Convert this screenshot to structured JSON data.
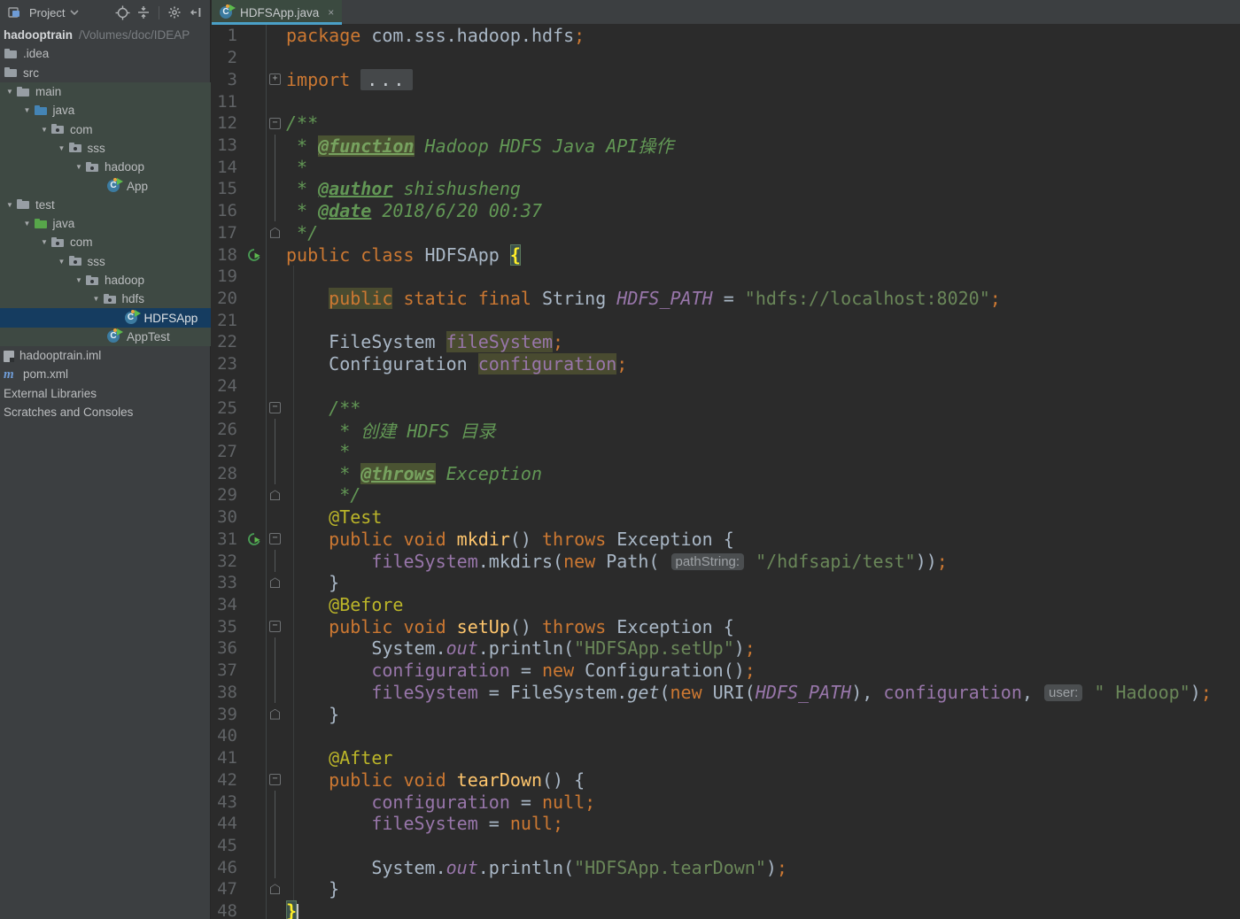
{
  "colors": {
    "accent_tab_underline": "#4AA0C8",
    "selection": "#153C60",
    "tree_tint": "#3E4943",
    "editor_bg": "#2B2B2B",
    "panel_bg": "#3C3F41",
    "keyword": "#CC7832",
    "string": "#6A8759",
    "comment": "#629755",
    "annotation": "#BBB529",
    "field": "#9876AA",
    "method": "#FFC66D",
    "usage_highlight": "#494B30",
    "brace_match": "#3B514D"
  },
  "panel": {
    "title": "Project",
    "toolbar_icons": [
      "project-view-icon",
      "chevron-down-icon",
      "locate-icon",
      "collapse-all-icon",
      "settings-icon",
      "hide-panel-icon"
    ],
    "tree": [
      {
        "name": "hadooptrain",
        "label": "hadooptrain",
        "sub": "/Volumes/doc/IDEAP",
        "lvl": 0,
        "root": true
      },
      {
        "name": "idea",
        "label": ".idea",
        "lvl": 0,
        "icon": "folder"
      },
      {
        "name": "src",
        "label": "src",
        "lvl": 0,
        "icon": "folder"
      },
      {
        "name": "main",
        "label": "main",
        "lvl": 0,
        "icon": "folder",
        "arrow": true,
        "tint": true
      },
      {
        "name": "main-java",
        "label": "java",
        "lvl": 1,
        "icon": "folder-blue",
        "arrow": true,
        "tint": true
      },
      {
        "name": "main-com",
        "label": "com",
        "lvl": 2,
        "icon": "package",
        "arrow": true,
        "tint": true
      },
      {
        "name": "main-sss",
        "label": "sss",
        "lvl": 3,
        "icon": "package",
        "arrow": true,
        "tint": true
      },
      {
        "name": "main-hadoop",
        "label": "hadoop",
        "lvl": 4,
        "icon": "package",
        "arrow": true,
        "tint": true
      },
      {
        "name": "app-class",
        "label": "App",
        "lvl": 6,
        "icon": "class",
        "tint": true
      },
      {
        "name": "test",
        "label": "test",
        "lvl": 0,
        "icon": "folder",
        "arrow": true,
        "tint": true
      },
      {
        "name": "test-java",
        "label": "java",
        "lvl": 1,
        "icon": "folder-green",
        "arrow": true,
        "tint": true
      },
      {
        "name": "test-com",
        "label": "com",
        "lvl": 2,
        "icon": "package",
        "arrow": true,
        "tint": true
      },
      {
        "name": "test-sss",
        "label": "sss",
        "lvl": 3,
        "icon": "package",
        "arrow": true,
        "tint": true
      },
      {
        "name": "test-hadoop",
        "label": "hadoop",
        "lvl": 4,
        "icon": "package",
        "arrow": true,
        "tint": true
      },
      {
        "name": "test-hdfs",
        "label": "hdfs",
        "lvl": 5,
        "icon": "package",
        "arrow": true,
        "tint": true
      },
      {
        "name": "hdfsapp-class",
        "label": "HDFSApp",
        "lvl": 7,
        "icon": "class",
        "selected": true
      },
      {
        "name": "apptest-class",
        "label": "AppTest",
        "lvl": 6,
        "icon": "class",
        "tint": true
      },
      {
        "name": "iml-file",
        "label": "hadooptrain.iml",
        "lvl": 0,
        "icon": "iml"
      },
      {
        "name": "pom-file",
        "label": "pom.xml",
        "lvl": 0,
        "icon": "maven"
      },
      {
        "name": "external-libraries",
        "label": "External Libraries",
        "lvl": 0
      },
      {
        "name": "scratches",
        "label": "Scratches and Consoles",
        "lvl": 0
      }
    ]
  },
  "editor": {
    "tab": {
      "label": "HDFSApp.java",
      "close": "×"
    },
    "lines": [
      {
        "n": 1,
        "tk": [
          [
            "k",
            "package"
          ],
          [
            "t",
            " com.sss.hadoop.hdfs"
          ],
          [
            "k",
            ";"
          ]
        ]
      },
      {
        "n": 2,
        "tk": []
      },
      {
        "n": 3,
        "f": "plus",
        "tk": [
          [
            "k",
            "import"
          ],
          [
            "t",
            " "
          ],
          [
            "x",
            "..."
          ]
        ]
      },
      {
        "n": 11,
        "tk": []
      },
      {
        "n": 12,
        "f": "minus",
        "tk": [
          [
            "c",
            "/**"
          ]
        ]
      },
      {
        "n": 13,
        "f": "line",
        "tk": [
          [
            "c",
            " * "
          ],
          [
            "gh",
            "@function"
          ],
          [
            "c",
            " Hadoop HDFS Java API操作"
          ]
        ]
      },
      {
        "n": 14,
        "f": "line",
        "tk": [
          [
            "c",
            " *"
          ]
        ]
      },
      {
        "n": 15,
        "f": "line",
        "tk": [
          [
            "c",
            " * "
          ],
          [
            "g",
            "@author"
          ],
          [
            "c",
            " shishusheng"
          ]
        ]
      },
      {
        "n": 16,
        "f": "line",
        "tk": [
          [
            "c",
            " * "
          ],
          [
            "g",
            "@date"
          ],
          [
            "c",
            " 2018/6/20 00:37"
          ]
        ]
      },
      {
        "n": 17,
        "f": "end",
        "tk": [
          [
            "c",
            " */"
          ]
        ]
      },
      {
        "n": 18,
        "r": true,
        "tk": [
          [
            "k",
            "public "
          ],
          [
            "k",
            "class "
          ],
          [
            "t",
            "HDFSApp "
          ],
          [
            "b",
            "{"
          ]
        ]
      },
      {
        "n": 19,
        "tk": []
      },
      {
        "n": 20,
        "tk": [
          [
            "t",
            "    "
          ],
          [
            "kh",
            "public"
          ],
          [
            "k",
            " static final"
          ],
          [
            "t",
            " String "
          ],
          [
            "fi",
            "HDFS_PATH"
          ],
          [
            "t",
            " = "
          ],
          [
            "s",
            "\"hdfs://localhost:8020\""
          ],
          [
            "k",
            ";"
          ]
        ]
      },
      {
        "n": 21,
        "tk": []
      },
      {
        "n": 22,
        "tk": [
          [
            "t",
            "    FileSystem "
          ],
          [
            "fh",
            "fileSystem"
          ],
          [
            "k",
            ";"
          ]
        ]
      },
      {
        "n": 23,
        "tk": [
          [
            "t",
            "    Configuration "
          ],
          [
            "fh",
            "configuration"
          ],
          [
            "k",
            ";"
          ]
        ]
      },
      {
        "n": 24,
        "tk": []
      },
      {
        "n": 25,
        "f": "minus",
        "tk": [
          [
            "t",
            "    "
          ],
          [
            "c",
            "/**"
          ]
        ]
      },
      {
        "n": 26,
        "f": "line",
        "tk": [
          [
            "c",
            "     * 创建 HDFS 目录"
          ]
        ]
      },
      {
        "n": 27,
        "f": "line",
        "tk": [
          [
            "c",
            "     *"
          ]
        ]
      },
      {
        "n": 28,
        "f": "line",
        "tk": [
          [
            "c",
            "     * "
          ],
          [
            "gh",
            "@throws"
          ],
          [
            "c",
            " Exception"
          ]
        ]
      },
      {
        "n": 29,
        "f": "end",
        "tk": [
          [
            "c",
            "     */"
          ]
        ]
      },
      {
        "n": 30,
        "tk": [
          [
            "t",
            "    "
          ],
          [
            "a",
            "@Test"
          ]
        ]
      },
      {
        "n": 31,
        "r": true,
        "f": "minus",
        "tk": [
          [
            "t",
            "    "
          ],
          [
            "k",
            "public void "
          ],
          [
            "m",
            "mkdir"
          ],
          [
            "t",
            "() "
          ],
          [
            "k",
            "throws"
          ],
          [
            "t",
            " Exception {"
          ]
        ]
      },
      {
        "n": 32,
        "f": "line",
        "tk": [
          [
            "t",
            "        "
          ],
          [
            "f",
            "fileSystem"
          ],
          [
            "t",
            ".mkdirs("
          ],
          [
            "k",
            "new"
          ],
          [
            "t",
            " Path( "
          ],
          [
            "h",
            "pathString:"
          ],
          [
            "s",
            " \"/hdfsapi/test\""
          ],
          [
            "t",
            "))"
          ],
          [
            "k",
            ";"
          ]
        ]
      },
      {
        "n": 33,
        "f": "end",
        "tk": [
          [
            "t",
            "    }"
          ]
        ]
      },
      {
        "n": 34,
        "tk": [
          [
            "t",
            "    "
          ],
          [
            "a",
            "@Before"
          ]
        ]
      },
      {
        "n": 35,
        "f": "minus",
        "tk": [
          [
            "t",
            "    "
          ],
          [
            "k",
            "public void "
          ],
          [
            "m",
            "setUp"
          ],
          [
            "t",
            "() "
          ],
          [
            "k",
            "throws"
          ],
          [
            "t",
            " Exception {"
          ]
        ]
      },
      {
        "n": 36,
        "f": "line",
        "tk": [
          [
            "t",
            "        System."
          ],
          [
            "fi",
            "out"
          ],
          [
            "t",
            ".println("
          ],
          [
            "s",
            "\"HDFSApp.setUp\""
          ],
          [
            "t",
            ")"
          ],
          [
            "k",
            ";"
          ]
        ]
      },
      {
        "n": 37,
        "f": "line",
        "tk": [
          [
            "t",
            "        "
          ],
          [
            "f",
            "configuration"
          ],
          [
            "t",
            " = "
          ],
          [
            "k",
            "new"
          ],
          [
            "t",
            " Configuration()"
          ],
          [
            "k",
            ";"
          ]
        ]
      },
      {
        "n": 38,
        "f": "line",
        "tk": [
          [
            "t",
            "        "
          ],
          [
            "f",
            "fileSystem"
          ],
          [
            "t",
            " = FileSystem."
          ],
          [
            "mi",
            "get"
          ],
          [
            "t",
            "("
          ],
          [
            "k",
            "new"
          ],
          [
            "t",
            " URI("
          ],
          [
            "fi",
            "HDFS_PATH"
          ],
          [
            "t",
            "), "
          ],
          [
            "f",
            "configuration"
          ],
          [
            "t",
            ", "
          ],
          [
            "h",
            "user:"
          ],
          [
            "s",
            " \" Hadoop\""
          ],
          [
            "t",
            ")"
          ],
          [
            "k",
            ";"
          ]
        ]
      },
      {
        "n": 39,
        "f": "end",
        "tk": [
          [
            "t",
            "    }"
          ]
        ]
      },
      {
        "n": 40,
        "tk": []
      },
      {
        "n": 41,
        "tk": [
          [
            "t",
            "    "
          ],
          [
            "a",
            "@After"
          ]
        ]
      },
      {
        "n": 42,
        "f": "minus",
        "tk": [
          [
            "t",
            "    "
          ],
          [
            "k",
            "public void "
          ],
          [
            "m",
            "tearDown"
          ],
          [
            "t",
            "() {"
          ]
        ]
      },
      {
        "n": 43,
        "f": "line",
        "tk": [
          [
            "t",
            "        "
          ],
          [
            "f",
            "configuration"
          ],
          [
            "t",
            " = "
          ],
          [
            "k",
            "null"
          ],
          [
            "k",
            ";"
          ]
        ]
      },
      {
        "n": 44,
        "f": "line",
        "tk": [
          [
            "t",
            "        "
          ],
          [
            "f",
            "fileSystem"
          ],
          [
            "t",
            " = "
          ],
          [
            "k",
            "null"
          ],
          [
            "k",
            ";"
          ]
        ]
      },
      {
        "n": 45,
        "f": "line",
        "tk": []
      },
      {
        "n": 46,
        "f": "line",
        "tk": [
          [
            "t",
            "        System."
          ],
          [
            "fi",
            "out"
          ],
          [
            "t",
            ".println("
          ],
          [
            "s",
            "\"HDFSApp.tearDown\""
          ],
          [
            "t",
            ")"
          ],
          [
            "k",
            ";"
          ]
        ]
      },
      {
        "n": 47,
        "f": "end",
        "tk": [
          [
            "t",
            "    }"
          ]
        ]
      },
      {
        "n": 48,
        "tk": [
          [
            "b",
            "}"
          ],
          [
            "caret",
            ""
          ]
        ]
      }
    ]
  }
}
